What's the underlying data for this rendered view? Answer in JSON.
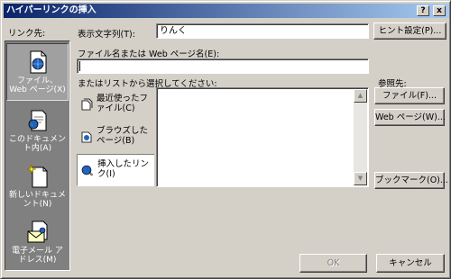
{
  "window": {
    "title": "ハイパーリンクの挿入",
    "help_button": "?",
    "close_button": "x"
  },
  "link_to": {
    "label": "リンク先:",
    "items": [
      {
        "label": "ファイル、Web ページ(X)",
        "icon": "web-page-icon",
        "selected": true
      },
      {
        "label": "このドキュメント内(A)",
        "icon": "document-place-icon",
        "selected": false
      },
      {
        "label": "新しいドキュメント(N)",
        "icon": "new-document-icon",
        "selected": false
      },
      {
        "label": "電子メール アドレス(M)",
        "icon": "email-icon",
        "selected": false
      }
    ]
  },
  "display_text": {
    "label": "表示文字列(T):",
    "value": "りんく",
    "screentip_button": "ヒント設定(P)..."
  },
  "address": {
    "label": "ファイル名または Web ページ名(E):",
    "value": ""
  },
  "list": {
    "label": "またはリストから選択してください:",
    "tabs": [
      {
        "label": "最近使ったファイル(C)",
        "icon": "recent-files-icon",
        "selected": false
      },
      {
        "label": "ブラウズしたページ(B)",
        "icon": "browsed-pages-icon",
        "selected": false
      },
      {
        "label": "挿入したリンク(I)",
        "icon": "inserted-links-icon",
        "selected": true
      }
    ],
    "items": []
  },
  "browse": {
    "label": "参照先:",
    "file_button": "ファイル(F)...",
    "web_page_button": "Web ページ(W)...",
    "bookmark_button": "ブックマーク(O)..."
  },
  "footer": {
    "ok_button": "OK",
    "cancel_button": "キャンセル"
  },
  "colors": {
    "face": "#d4d0c8",
    "title_start": "#0a246a",
    "title_end": "#a6caf0",
    "linkbar": "#808080"
  }
}
